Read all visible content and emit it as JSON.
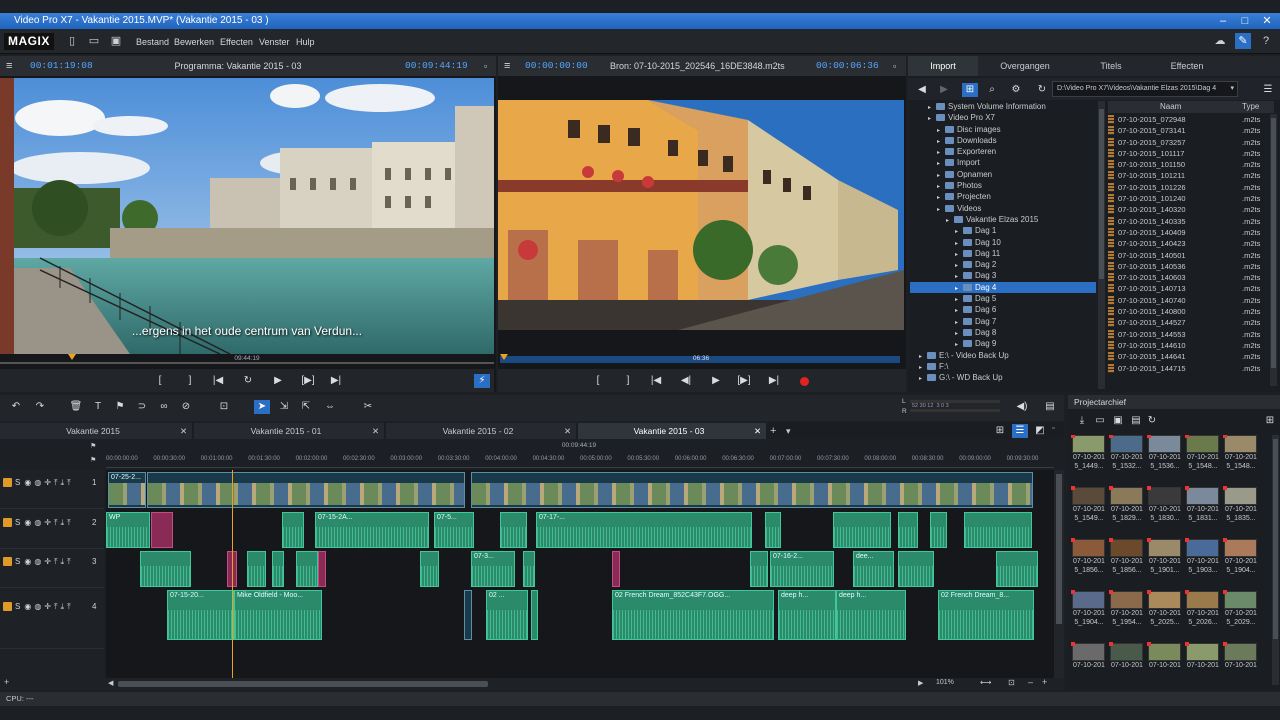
{
  "window": {
    "title": "Video Pro X7 - Vakantie 2015.MVP* (Vakantie 2015 - 03 )"
  },
  "menu": {
    "logo": "MAGIX",
    "items": [
      "Bestand",
      "Bewerken",
      "Effecten",
      "Venster",
      "Hulp"
    ]
  },
  "program_monitor": {
    "timecode_left": "00:01:19:08",
    "title": "Programma: Vakantie 2015 - 03",
    "timecode_right": "00:09:44:19",
    "subtitle": "...ergens in het oude centrum van Verdun...",
    "scrub_time": "09:44:19"
  },
  "source_monitor": {
    "timecode_left": "00:00:00:00",
    "title": "Bron: 07-10-2015_202546_16DE3848.m2ts",
    "timecode_right": "00:00:06:36",
    "scrub_time": "06:36"
  },
  "import_panel": {
    "tabs": [
      "Import",
      "Overgangen",
      "Titels",
      "Effecten"
    ],
    "path": "D:\\Video Pro X7\\Videos\\Vakantie Elzas 2015\\Dag 4",
    "tree": [
      {
        "label": "System Volume Information",
        "indent": 2
      },
      {
        "label": "Video Pro X7",
        "indent": 2
      },
      {
        "label": "Disc images",
        "indent": 3
      },
      {
        "label": "Downloads",
        "indent": 3
      },
      {
        "label": "Exporteren",
        "indent": 3
      },
      {
        "label": "Import",
        "indent": 3
      },
      {
        "label": "Opnamen",
        "indent": 3
      },
      {
        "label": "Photos",
        "indent": 3
      },
      {
        "label": "Projecten",
        "indent": 3
      },
      {
        "label": "Videos",
        "indent": 3
      },
      {
        "label": "Vakantie Elzas 2015",
        "indent": 4
      },
      {
        "label": "Dag 1",
        "indent": 5
      },
      {
        "label": "Dag 10",
        "indent": 5
      },
      {
        "label": "Dag 11",
        "indent": 5
      },
      {
        "label": "Dag 2",
        "indent": 5
      },
      {
        "label": "Dag 3",
        "indent": 5
      },
      {
        "label": "Dag 4",
        "indent": 5,
        "selected": true
      },
      {
        "label": "Dag 5",
        "indent": 5
      },
      {
        "label": "Dag 6",
        "indent": 5
      },
      {
        "label": "Dag 7",
        "indent": 5
      },
      {
        "label": "Dag 8",
        "indent": 5
      },
      {
        "label": "Dag 9",
        "indent": 5
      },
      {
        "label": "E:\\ - Video Back Up",
        "indent": 1
      },
      {
        "label": "F:\\",
        "indent": 1
      },
      {
        "label": "G:\\ - WD Back Up",
        "indent": 1
      }
    ],
    "file_columns": {
      "name": "Naam",
      "type": "Type"
    },
    "files": [
      {
        "name": "07-10-2015_072948",
        "type": ".m2ts"
      },
      {
        "name": "07-10-2015_073141",
        "type": ".m2ts"
      },
      {
        "name": "07-10-2015_073257",
        "type": ".m2ts"
      },
      {
        "name": "07-10-2015_101117",
        "type": ".m2ts"
      },
      {
        "name": "07-10-2015_101150",
        "type": ".m2ts"
      },
      {
        "name": "07-10-2015_101211",
        "type": ".m2ts"
      },
      {
        "name": "07-10-2015_101226",
        "type": ".m2ts"
      },
      {
        "name": "07-10-2015_101240",
        "type": ".m2ts"
      },
      {
        "name": "07-10-2015_140320",
        "type": ".m2ts"
      },
      {
        "name": "07-10-2015_140335",
        "type": ".m2ts"
      },
      {
        "name": "07-10-2015_140409",
        "type": ".m2ts"
      },
      {
        "name": "07-10-2015_140423",
        "type": ".m2ts"
      },
      {
        "name": "07-10-2015_140501",
        "type": ".m2ts"
      },
      {
        "name": "07-10-2015_140536",
        "type": ".m2ts"
      },
      {
        "name": "07-10-2015_140603",
        "type": ".m2ts"
      },
      {
        "name": "07-10-2015_140713",
        "type": ".m2ts"
      },
      {
        "name": "07-10-2015_140740",
        "type": ".m2ts"
      },
      {
        "name": "07-10-2015_140800",
        "type": ".m2ts"
      },
      {
        "name": "07-10-2015_144527",
        "type": ".m2ts"
      },
      {
        "name": "07-10-2015_144553",
        "type": ".m2ts"
      },
      {
        "name": "07-10-2015_144610",
        "type": ".m2ts"
      },
      {
        "name": "07-10-2015_144641",
        "type": ".m2ts"
      },
      {
        "name": "07-10-2015_144715",
        "type": ".m2ts"
      }
    ]
  },
  "meter": {
    "label_l": "L",
    "label_r": "R",
    "scale": "52 30 12  3 0 3"
  },
  "timeline": {
    "tabs": [
      "Vakantie 2015",
      "Vakantie 2015 - 01",
      "Vakantie 2015 - 02",
      "Vakantie 2015 - 03"
    ],
    "position": "00:09:44:19",
    "ruler": [
      "00:00:00:00",
      "00:00:30:00",
      "00:01:00:00",
      "00:01:30:00",
      "00:02:00:00",
      "00:02:30:00",
      "00:03:00:00",
      "00:03:30:00",
      "00:04:00:00",
      "00:04:30:00",
      "00:05:00:00",
      "00:05:30:00",
      "00:06:00:00",
      "00:06:30:00",
      "00:07:00:00",
      "00:07:30:00",
      "00:08:00:00",
      "00:08:30:00",
      "00:09:00:00",
      "00:09:30:00"
    ],
    "tracks": [
      "1",
      "2",
      "3",
      "4"
    ],
    "track_letter": "S",
    "clip_labels": {
      "t2a": "WP",
      "t2b": "07-15-2A...",
      "t2c": "07-5...",
      "t2d": "07-17-...",
      "t3a": "07-3...",
      "t3b": "07-16-2...",
      "t3c": "dee...",
      "t4a": "07-15-20...",
      "t4b": "Mike Oldfield - Moo...",
      "t4c": "02 ...",
      "t4d": "02 French Dream_852C43F7.OGG...",
      "t4e": "deep h...",
      "t4f": "deep h...",
      "t4g": "02 French Dream_8...",
      "t1a": "07-25-2..."
    },
    "zoom": "101%",
    "status": "CPU: ---"
  },
  "archive": {
    "title": "Projectarchief",
    "rows": [
      [
        "07-10-201 5_1449...",
        "07-10-201 5_1532...",
        "07-10-201 5_1536...",
        "07-10-201 5_1548...",
        "07-10-201 5_1548..."
      ],
      [
        "07-10-201 5_1549...",
        "07-10-201 5_1829...",
        "07-10-201 5_1830...",
        "07-10-201 5_1831...",
        "07-10-201 5_1835..."
      ],
      [
        "07-10-201 5_1856...",
        "07-10-201 5_1856...",
        "07-10-201 5_1901...",
        "07-10-201 5_1903...",
        "07-10-201 5_1904..."
      ],
      [
        "07-10-201 5_1904...",
        "07-10-201 5_1954...",
        "07-10-201 5_2025...",
        "07-10-201 5_2026...",
        "07-10-201 5_2029..."
      ],
      [
        "07-10-201",
        "07-10-201",
        "07-10-201",
        "07-10-201",
        "07-10-201"
      ]
    ],
    "thumb_colors": [
      [
        "#8a9a6a",
        "#4c6a8a",
        "#7a8a9a",
        "#6a7a4a",
        "#9a8a6a"
      ],
      [
        "#5a4a3a",
        "#8a7a5a",
        "#3a3a3a",
        "#7a8a9a",
        "#9a9a8a"
      ],
      [
        "#8a5a3a",
        "#6a4a2a",
        "#9a8a6a",
        "#4a6a9a",
        "#aa7a5a"
      ],
      [
        "#5a6a8a",
        "#8a6a4a",
        "#aa8a5a",
        "#9a7a4a",
        "#6a8a6a"
      ],
      [
        "#6a6a6a",
        "#4a5a4a",
        "#7a8a5a",
        "#8a9a6a",
        "#6a7a5a"
      ]
    ]
  }
}
